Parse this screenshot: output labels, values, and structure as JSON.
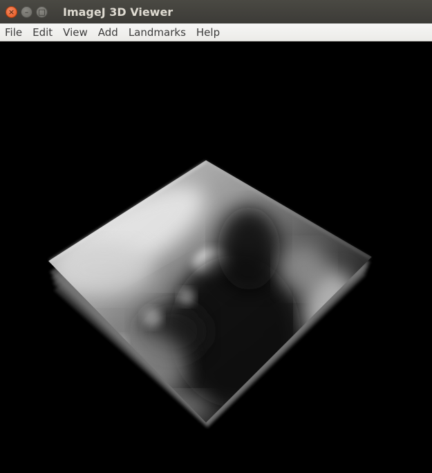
{
  "window": {
    "title": "ImageJ 3D Viewer",
    "controls": {
      "close_glyph": "×",
      "minimize_glyph": "–",
      "maximize_glyph": "□"
    }
  },
  "menubar": {
    "items": [
      "File",
      "Edit",
      "View",
      "Add",
      "Landmarks",
      "Help"
    ]
  },
  "viewport": {
    "background_color": "#000000",
    "content": "grayscale-volume-rendering"
  }
}
